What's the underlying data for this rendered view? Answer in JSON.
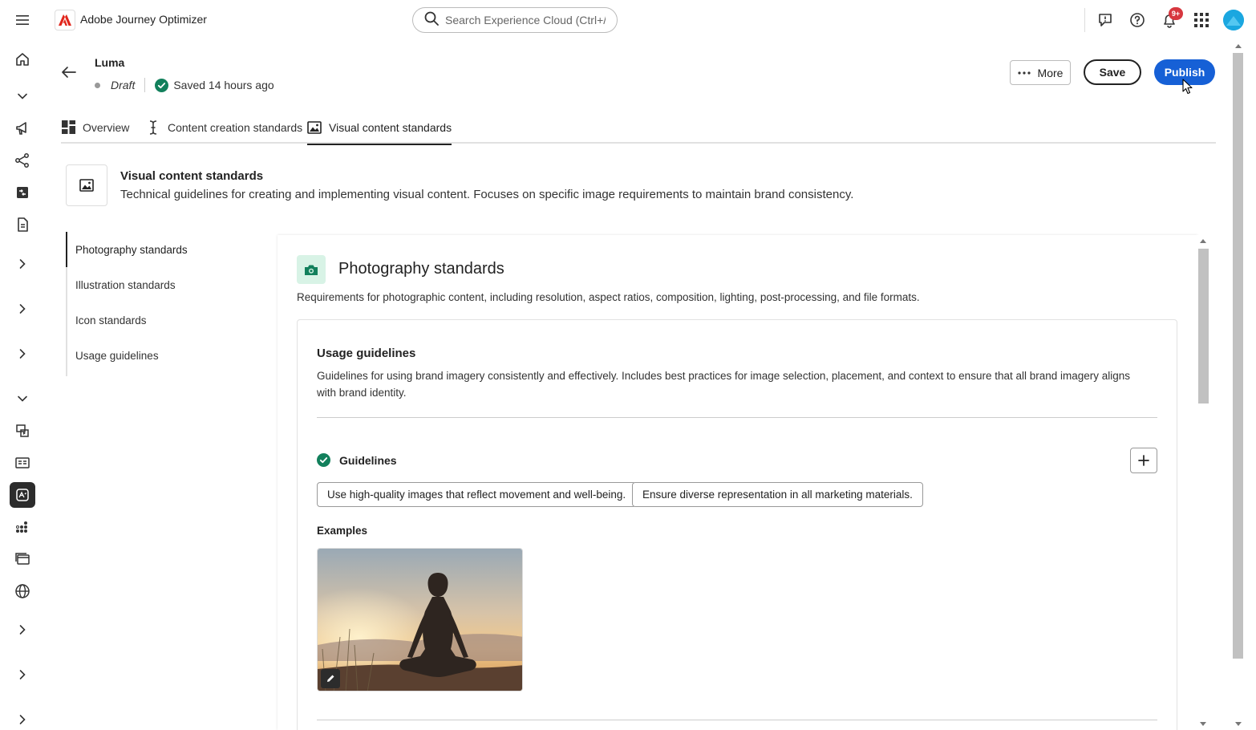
{
  "app": {
    "name": "Adobe Journey Optimizer"
  },
  "search": {
    "placeholder": "Search Experience Cloud (Ctrl+/)"
  },
  "topbar": {
    "icons": [
      "feedback-icon",
      "help-icon",
      "bell-icon",
      "apps-grid-icon"
    ],
    "notification_badge": "9+"
  },
  "rail": {
    "items": [
      "home-icon",
      "chevron-down-icon",
      "campaigns-icon",
      "journeys-icon",
      "content-icon",
      "templates-icon",
      "chevron-right-icon",
      "chevron-right-icon",
      "chevron-right-icon",
      "chevron-down-icon",
      "fragments-icon",
      "offers-icon",
      "brand-icon",
      "segments-icon",
      "channels-icon",
      "globe-icon",
      "chevron-right-icon",
      "chevron-right-icon",
      "chevron-right-icon"
    ],
    "active": "brand-icon"
  },
  "header": {
    "title": "Luma",
    "status": "Draft",
    "saved": "Saved 14 hours ago",
    "more_label": "More",
    "save_label": "Save",
    "publish_label": "Publish"
  },
  "tabs": [
    {
      "label": "Overview",
      "icon": "dashboard-icon"
    },
    {
      "label": "Content creation standards",
      "icon": "text-cursor-icon"
    },
    {
      "label": "Visual content standards",
      "icon": "image-icon",
      "active": true
    }
  ],
  "section": {
    "title": "Visual content standards",
    "description": "Technical guidelines for creating and implementing visual content. Focuses on specific image requirements to maintain brand consistency."
  },
  "subnav": [
    {
      "label": "Photography standards",
      "active": true
    },
    {
      "label": "Illustration standards"
    },
    {
      "label": "Icon standards"
    },
    {
      "label": "Usage guidelines"
    }
  ],
  "photography": {
    "title": "Photography standards",
    "description": "Requirements for photographic content, including resolution, aspect ratios, composition, lighting, post-processing, and file formats.",
    "card": {
      "title": "Usage guidelines",
      "description": "Guidelines for using brand imagery consistently and effectively. Includes best practices for image selection, placement, and context to ensure that all brand imagery aligns with brand identity.",
      "guidelines_label": "Guidelines",
      "guidelines": [
        "Use high-quality images that reflect movement and well-being.",
        "Ensure diverse representation in all marketing materials."
      ],
      "examples_label": "Examples"
    }
  },
  "colors": {
    "accent": "#1660d6",
    "success": "#12805c",
    "badge": "#d7373f"
  }
}
